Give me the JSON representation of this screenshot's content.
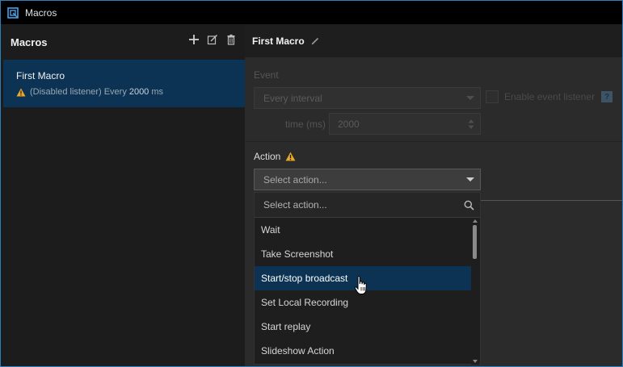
{
  "window": {
    "title": "Macros"
  },
  "sidebar": {
    "title": "Macros",
    "macros": [
      {
        "name": "First Macro",
        "status_prefix": "(Disabled listener) Every",
        "interval": "2000",
        "unit": "ms"
      }
    ]
  },
  "main": {
    "title": "First Macro",
    "event": {
      "label": "Event",
      "selected": "Every interval",
      "enable_label": "Enable event listener",
      "help": "?",
      "time_label": "time (ms)",
      "time_value": "2000"
    },
    "action": {
      "label": "Action",
      "placeholder": "Select action...",
      "search_placeholder": "Select action...",
      "options": [
        "Wait",
        "Take Screenshot",
        "Start/stop broadcast",
        "Set Local Recording",
        "Start replay",
        "Slideshow Action"
      ],
      "highlighted": "Start/stop broadcast"
    }
  },
  "colors": {
    "accent": "#0c3353",
    "warning": "#e8a82a",
    "border": "#2f7fbf"
  }
}
